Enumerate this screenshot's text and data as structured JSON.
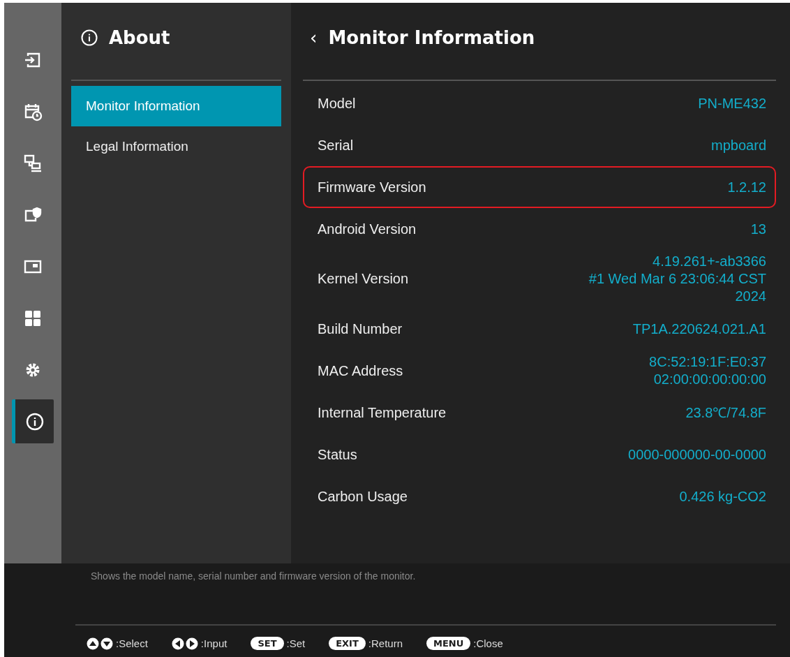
{
  "sidebar": {
    "items": [
      {
        "kind": "input",
        "selected": false
      },
      {
        "kind": "schedule",
        "selected": false
      },
      {
        "kind": "network",
        "selected": false
      },
      {
        "kind": "security",
        "selected": false
      },
      {
        "kind": "pip",
        "selected": false
      },
      {
        "kind": "apps",
        "selected": false
      },
      {
        "kind": "settings",
        "selected": false
      },
      {
        "kind": "info",
        "selected": true
      }
    ]
  },
  "menu": {
    "title": "About",
    "items": [
      {
        "label": "Monitor Information",
        "selected": true
      },
      {
        "label": "Legal Information",
        "selected": false
      }
    ]
  },
  "detail": {
    "title": "Monitor Information",
    "back": "‹",
    "rows": [
      {
        "label": "Model",
        "value": [
          "PN-ME432"
        ],
        "highlighted": false
      },
      {
        "label": "Serial",
        "value": [
          "mpboard"
        ],
        "highlighted": false
      },
      {
        "label": "Firmware Version",
        "value": [
          "1.2.12"
        ],
        "highlighted": true
      },
      {
        "label": "Android Version",
        "value": [
          "13"
        ],
        "highlighted": false
      },
      {
        "label": "Kernel Version",
        "value": [
          "4.19.261+-ab3366",
          "#1 Wed Mar 6 23:06:44 CST",
          "2024"
        ],
        "highlighted": false
      },
      {
        "label": "Build Number",
        "value": [
          "TP1A.220624.021.A1"
        ],
        "highlighted": false
      },
      {
        "label": "MAC Address",
        "value": [
          "8C:52:19:1F:E0:37",
          "02:00:00:00:00:00"
        ],
        "highlighted": false
      },
      {
        "label": "Internal Temperature",
        "value": [
          "23.8℃/74.8F"
        ],
        "highlighted": false
      },
      {
        "label": "Status",
        "value": [
          "0000-000000-00-0000"
        ],
        "highlighted": false
      },
      {
        "label": "Carbon Usage",
        "value": [
          "0.426 kg-CO2"
        ],
        "highlighted": false
      }
    ]
  },
  "description": "Shows the model name, serial number and firmware version of the monitor.",
  "hints": [
    {
      "kind": "updown",
      "label": ":Select"
    },
    {
      "kind": "leftright",
      "label": ":Input"
    },
    {
      "kind": "key",
      "key": "SET",
      "label": ":Set"
    },
    {
      "kind": "key",
      "key": "EXIT",
      "label": ":Return"
    },
    {
      "kind": "key",
      "key": "MENU",
      "label": ":Close"
    }
  ]
}
